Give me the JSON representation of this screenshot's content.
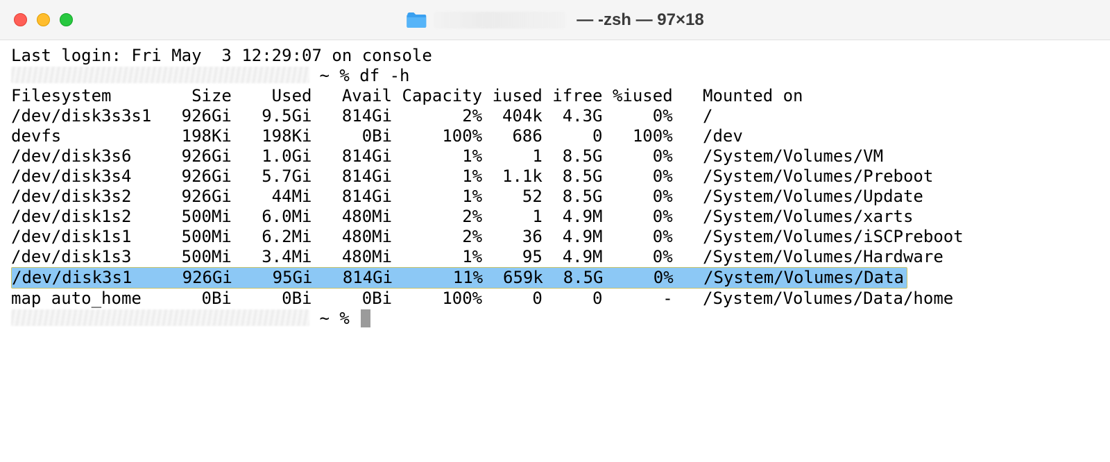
{
  "titlebar": {
    "title_suffix": "— -zsh — 97×18"
  },
  "session": {
    "last_login": "Last login: Fri May  3 12:29:07 on console",
    "prompt_prefix": "~ %",
    "command": "df -h"
  },
  "df": {
    "header": {
      "filesystem": "Filesystem",
      "size": "Size",
      "used": "Used",
      "avail": "Avail",
      "capacity": "Capacity",
      "iused": "iused",
      "ifree": "ifree",
      "piused": "%iused",
      "mounted": "Mounted on"
    },
    "rows": [
      {
        "filesystem": "/dev/disk3s3s1",
        "size": "926Gi",
        "used": "9.5Gi",
        "avail": "814Gi",
        "capacity": "2%",
        "iused": "404k",
        "ifree": "4.3G",
        "piused": "0%",
        "mounted": "/",
        "highlighted": false
      },
      {
        "filesystem": "devfs",
        "size": "198Ki",
        "used": "198Ki",
        "avail": "0Bi",
        "capacity": "100%",
        "iused": "686",
        "ifree": "0",
        "piused": "100%",
        "mounted": "/dev",
        "highlighted": false
      },
      {
        "filesystem": "/dev/disk3s6",
        "size": "926Gi",
        "used": "1.0Gi",
        "avail": "814Gi",
        "capacity": "1%",
        "iused": "1",
        "ifree": "8.5G",
        "piused": "0%",
        "mounted": "/System/Volumes/VM",
        "highlighted": false
      },
      {
        "filesystem": "/dev/disk3s4",
        "size": "926Gi",
        "used": "5.7Gi",
        "avail": "814Gi",
        "capacity": "1%",
        "iused": "1.1k",
        "ifree": "8.5G",
        "piused": "0%",
        "mounted": "/System/Volumes/Preboot",
        "highlighted": false
      },
      {
        "filesystem": "/dev/disk3s2",
        "size": "926Gi",
        "used": "44Mi",
        "avail": "814Gi",
        "capacity": "1%",
        "iused": "52",
        "ifree": "8.5G",
        "piused": "0%",
        "mounted": "/System/Volumes/Update",
        "highlighted": false
      },
      {
        "filesystem": "/dev/disk1s2",
        "size": "500Mi",
        "used": "6.0Mi",
        "avail": "480Mi",
        "capacity": "2%",
        "iused": "1",
        "ifree": "4.9M",
        "piused": "0%",
        "mounted": "/System/Volumes/xarts",
        "highlighted": false
      },
      {
        "filesystem": "/dev/disk1s1",
        "size": "500Mi",
        "used": "6.2Mi",
        "avail": "480Mi",
        "capacity": "2%",
        "iused": "36",
        "ifree": "4.9M",
        "piused": "0%",
        "mounted": "/System/Volumes/iSCPreboot",
        "highlighted": false
      },
      {
        "filesystem": "/dev/disk1s3",
        "size": "500Mi",
        "used": "3.4Mi",
        "avail": "480Mi",
        "capacity": "1%",
        "iused": "95",
        "ifree": "4.9M",
        "piused": "0%",
        "mounted": "/System/Volumes/Hardware",
        "highlighted": false
      },
      {
        "filesystem": "/dev/disk3s1",
        "size": "926Gi",
        "used": "95Gi",
        "avail": "814Gi",
        "capacity": "11%",
        "iused": "659k",
        "ifree": "8.5G",
        "piused": "0%",
        "mounted": "/System/Volumes/Data",
        "highlighted": true
      },
      {
        "filesystem": "map auto_home",
        "size": "0Bi",
        "used": "0Bi",
        "avail": "0Bi",
        "capacity": "100%",
        "iused": "0",
        "ifree": "0",
        "piused": "-",
        "mounted": "/System/Volumes/Data/home",
        "highlighted": false
      }
    ]
  }
}
